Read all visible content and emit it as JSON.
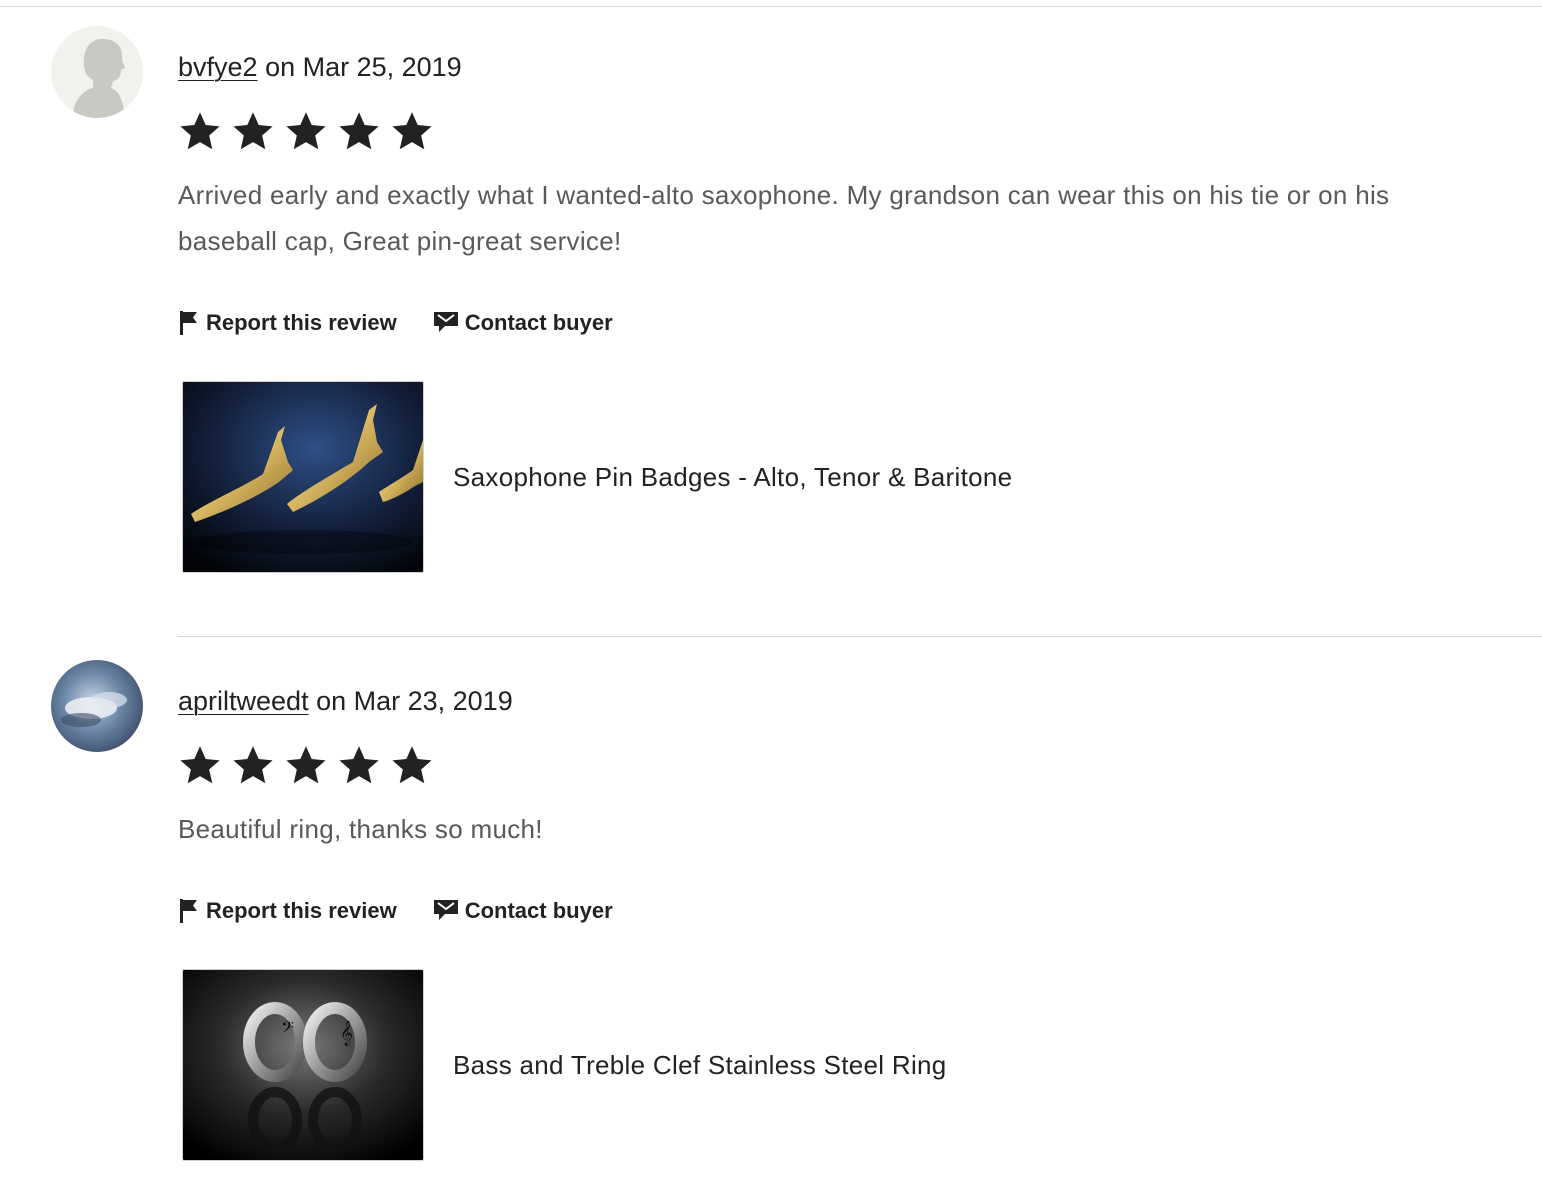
{
  "reviews": [
    {
      "username": "bvfye2",
      "date_text": " on Mar 25, 2019",
      "avatar_icon": "default-person-avatar",
      "rating": 5,
      "text": "Arrived early and exactly what I wanted-alto saxophone. My grandson can wear this on his tie or on his baseball cap, Great pin-great service!",
      "report_label": "Report this review",
      "contact_label": "Contact buyer",
      "listing_title": "Saxophone Pin Badges - Alto, Tenor & Baritone"
    },
    {
      "username": "apriltweedt",
      "date_text": " on Mar 23, 2019",
      "avatar_icon": "sky-clouds-avatar",
      "rating": 5,
      "text": "Beautiful ring, thanks so much!",
      "report_label": "Report this review",
      "contact_label": "Contact buyer",
      "listing_title": "Bass and Treble Clef Stainless Steel Ring"
    }
  ],
  "icons": {
    "star": "star-icon",
    "report": "flag-icon",
    "contact": "message-icon"
  },
  "colors": {
    "text_primary": "#222222",
    "text_secondary": "#595959",
    "divider": "#d9d9d9"
  }
}
